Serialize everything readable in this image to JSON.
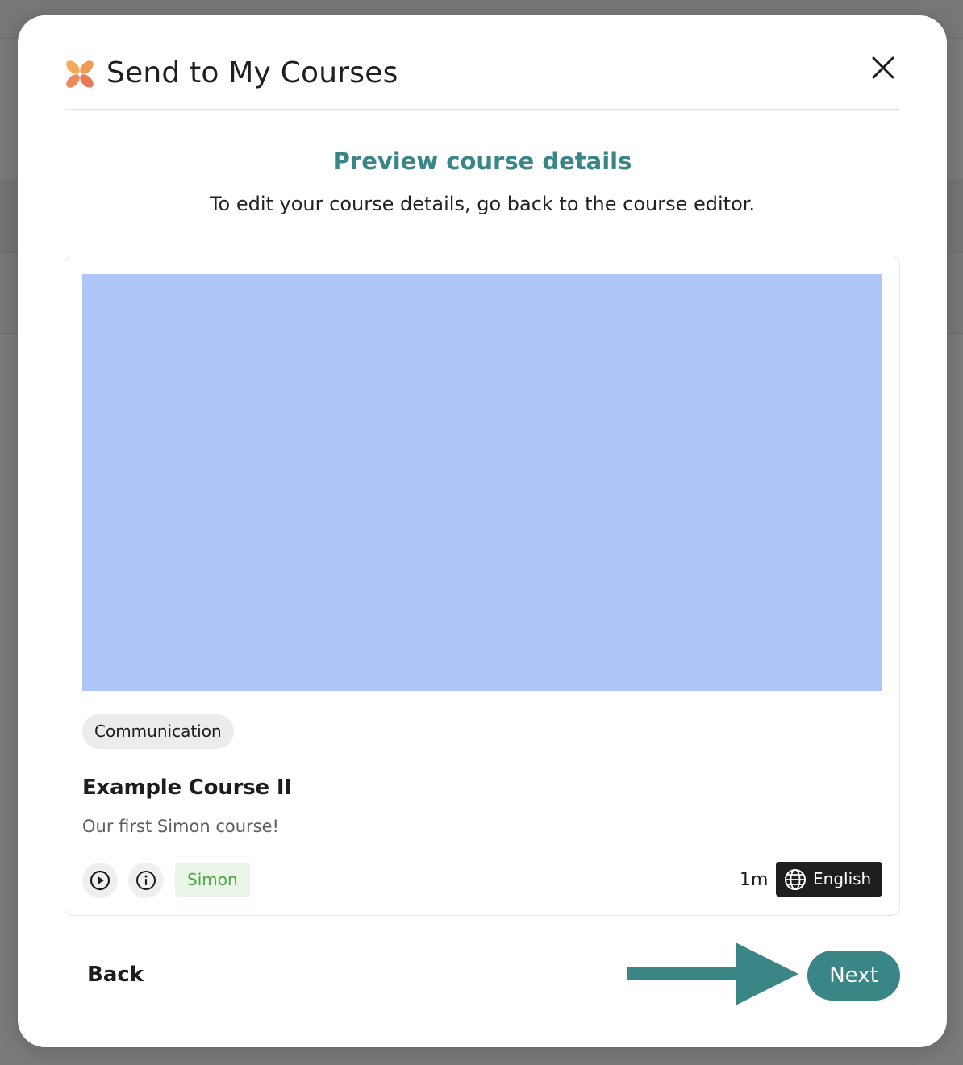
{
  "modal": {
    "title": "Send to My Courses",
    "close_icon": "close-icon",
    "logo_icon": "brand-logo-icon",
    "accent_color": "#3a8585"
  },
  "preview": {
    "heading": "Preview course details",
    "subheading": "To edit your course details, go back to the course editor."
  },
  "course_card": {
    "thumbnail_color": "#adc5f7",
    "category": "Communication",
    "title": "Example Course II",
    "description": "Our first Simon course!",
    "play_icon": "play-circle-icon",
    "info_icon": "info-circle-icon",
    "author": "Simon",
    "duration": "1m",
    "language": "English",
    "language_icon": "globe-icon"
  },
  "footer": {
    "back_label": "Back",
    "next_label": "Next",
    "annotation_icon": "arrow-right-icon"
  }
}
